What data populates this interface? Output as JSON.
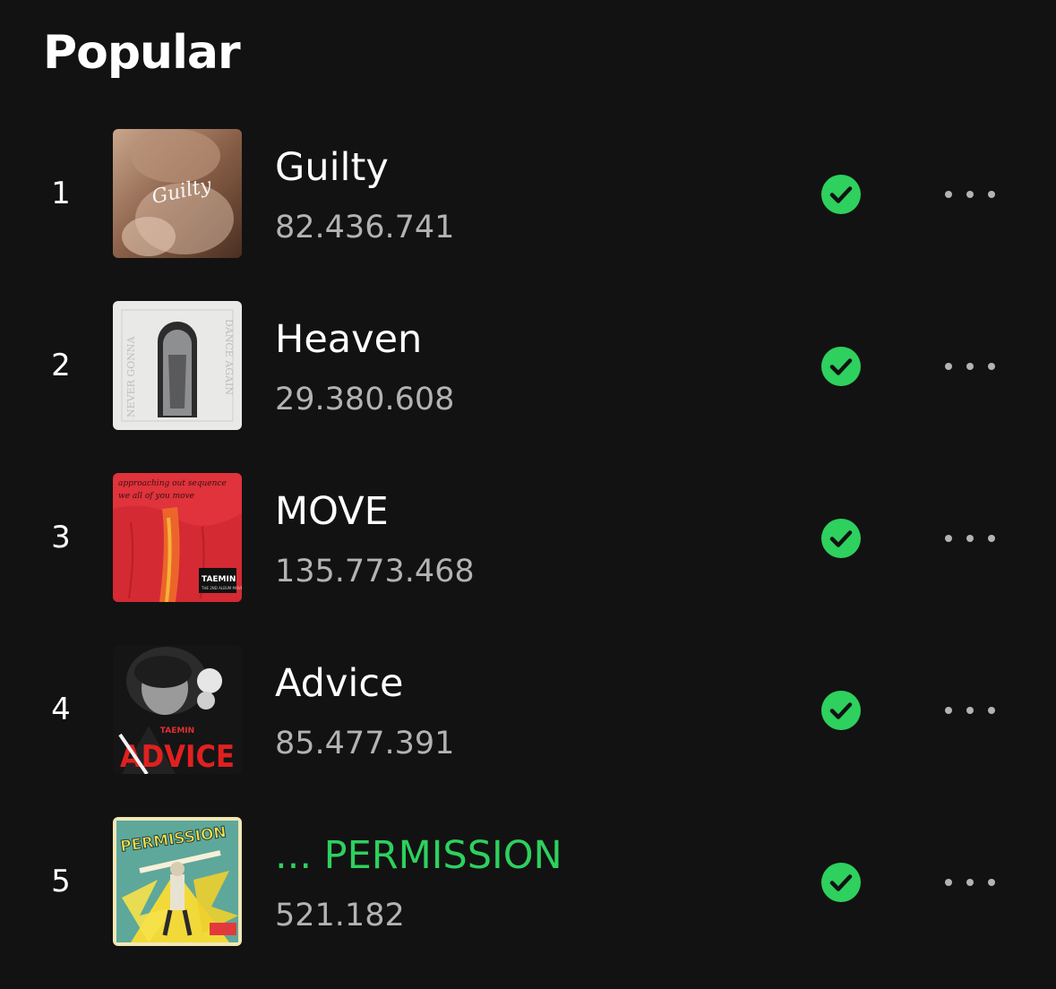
{
  "section": {
    "title": "Popular"
  },
  "colors": {
    "background": "#121212",
    "accent": "#2ed05e",
    "secondary_text": "#b3b3b3"
  },
  "tracks": [
    {
      "rank": "1",
      "title": "Guilty",
      "plays": "82.436.741",
      "saved": true,
      "now_playing": false,
      "art_text": "Guilty"
    },
    {
      "rank": "2",
      "title": "Heaven",
      "plays": "29.380.608",
      "saved": true,
      "now_playing": false,
      "art_text": "NEVER GONNA DANCE AGAIN"
    },
    {
      "rank": "3",
      "title": "MOVE",
      "plays": "135.773.468",
      "saved": true,
      "now_playing": false,
      "art_text": "TAEMIN"
    },
    {
      "rank": "4",
      "title": "Advice",
      "plays": "85.477.391",
      "saved": true,
      "now_playing": false,
      "art_text": "ADVICE"
    },
    {
      "rank": "5",
      "title": "... PERMISSION",
      "plays": "521.182",
      "saved": true,
      "now_playing": true,
      "art_text": "PERMISSION"
    }
  ],
  "icons": {
    "saved": "check-circle-icon",
    "more": "more-options-icon"
  }
}
